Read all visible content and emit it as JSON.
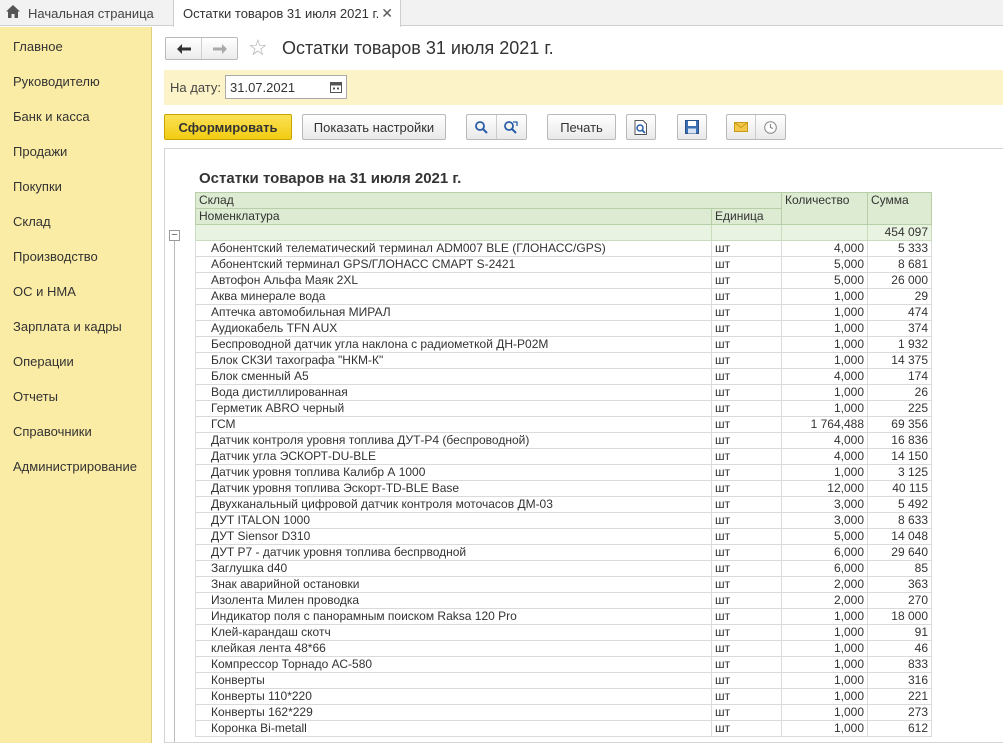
{
  "tabs": {
    "home_label": "Начальная страница",
    "doc_label": "Остатки товаров 31 июля 2021 г.",
    "close_glyph": "✕"
  },
  "sidebar": {
    "items": [
      {
        "label": "Главное"
      },
      {
        "label": "Руководителю"
      },
      {
        "label": "Банк и касса"
      },
      {
        "label": "Продажи"
      },
      {
        "label": "Покупки"
      },
      {
        "label": "Склад"
      },
      {
        "label": "Производство"
      },
      {
        "label": "ОС и НМА"
      },
      {
        "label": "Зарплата и кадры"
      },
      {
        "label": "Операции"
      },
      {
        "label": "Отчеты"
      },
      {
        "label": "Справочники"
      },
      {
        "label": "Администрирование"
      }
    ]
  },
  "header": {
    "back_glyph": "🡐",
    "forward_glyph": "🡒",
    "star_glyph": "☆",
    "title": "Остатки товаров 31 июля 2021 г."
  },
  "filters": {
    "date_label": "На дату:",
    "date_value": "31.07.2021"
  },
  "toolbar": {
    "generate_label": "Сформировать",
    "settings_label": "Показать настройки",
    "print_label": "Печать"
  },
  "report": {
    "title": "Остатки товаров на 31 июля 2021 г.",
    "col_warehouse": "Склад",
    "col_item": "Номенклатура",
    "col_unit": "Единица",
    "col_qty": "Количество",
    "col_sum": "Сумма",
    "outline_glyph": "−",
    "total_sum": "454 097",
    "rows": [
      {
        "name": "Абонентский телематический терминал ADM007 BLE (ГЛОНАСС/GPS)",
        "unit": "шт",
        "qty": "4,000",
        "sum": "5 333"
      },
      {
        "name": "Абонентский терминал GPS/ГЛОНАСС СМАРТ S-2421",
        "unit": "шт",
        "qty": "5,000",
        "sum": "8 681"
      },
      {
        "name": "Автофон Альфа Маяк 2XL",
        "unit": "шт",
        "qty": "5,000",
        "sum": "26 000"
      },
      {
        "name": "Аква минерале вода",
        "unit": "шт",
        "qty": "1,000",
        "sum": "29"
      },
      {
        "name": "Аптечка автомобильная МИРАЛ",
        "unit": "шт",
        "qty": "1,000",
        "sum": "474"
      },
      {
        "name": "Аудиокабель TFN AUX",
        "unit": "шт",
        "qty": "1,000",
        "sum": "374"
      },
      {
        "name": "Беспроводной датчик угла наклона с радиометкой ДН-Р02М",
        "unit": "шт",
        "qty": "1,000",
        "sum": "1 932"
      },
      {
        "name": "Блок СКЗИ тахографа \"НКМ-К\"",
        "unit": "шт",
        "qty": "1,000",
        "sum": "14 375"
      },
      {
        "name": "Блок сменный А5",
        "unit": "шт",
        "qty": "4,000",
        "sum": "174"
      },
      {
        "name": "Вода дистиллированная",
        "unit": "шт",
        "qty": "1,000",
        "sum": "26"
      },
      {
        "name": "Герметик ABRO черный",
        "unit": "шт",
        "qty": "1,000",
        "sum": "225"
      },
      {
        "name": "ГСМ",
        "unit": "шт",
        "qty": "1 764,488",
        "sum": "69 356"
      },
      {
        "name": "Датчик контроля уровня топлива ДУТ-Р4 (беспроводной)",
        "unit": "шт",
        "qty": "4,000",
        "sum": "16 836"
      },
      {
        "name": "Датчик угла ЭСКОРТ-DU-BLE",
        "unit": "шт",
        "qty": "4,000",
        "sum": "14 150"
      },
      {
        "name": "Датчик уровня топлива Калибр А 1000",
        "unit": "шт",
        "qty": "1,000",
        "sum": "3 125"
      },
      {
        "name": "Датчик уровня топлива Эскорт-TD-BLE Base",
        "unit": "шт",
        "qty": "12,000",
        "sum": "40 115"
      },
      {
        "name": "Двухканальный цифровой датчик контроля моточасов ДМ-03",
        "unit": "шт",
        "qty": "3,000",
        "sum": "5 492"
      },
      {
        "name": "ДУТ ITALON 1000",
        "unit": "шт",
        "qty": "3,000",
        "sum": "8 633"
      },
      {
        "name": "ДУТ Siensor D310",
        "unit": "шт",
        "qty": "5,000",
        "sum": "14 048"
      },
      {
        "name": "ДУТ Р7 - датчик уровня топлива беспрводной",
        "unit": "шт",
        "qty": "6,000",
        "sum": "29 640"
      },
      {
        "name": "Заглушка d40",
        "unit": "шт",
        "qty": "6,000",
        "sum": "85"
      },
      {
        "name": "Знак аварийной остановки",
        "unit": "шт",
        "qty": "2,000",
        "sum": "363"
      },
      {
        "name": "Изолента Милен проводка",
        "unit": "шт",
        "qty": "2,000",
        "sum": "270"
      },
      {
        "name": "Индикатор поля с панорамным поиском Raksa 120 Pro",
        "unit": "шт",
        "qty": "1,000",
        "sum": "18 000"
      },
      {
        "name": "Клей-карандаш скотч",
        "unit": "шт",
        "qty": "1,000",
        "sum": "91"
      },
      {
        "name": "клейкая лента 48*66",
        "unit": "шт",
        "qty": "1,000",
        "sum": "46"
      },
      {
        "name": "Компрессор Торнадо АС-580",
        "unit": "шт",
        "qty": "1,000",
        "sum": "833"
      },
      {
        "name": "Конверты",
        "unit": "шт",
        "qty": "1,000",
        "sum": "316"
      },
      {
        "name": "Конверты 110*220",
        "unit": "шт",
        "qty": "1,000",
        "sum": "221"
      },
      {
        "name": "Конверты 162*229",
        "unit": "шт",
        "qty": "1,000",
        "sum": "273"
      },
      {
        "name": "Коронка Bi-metall",
        "unit": "шт",
        "qty": "1,000",
        "sum": "612"
      }
    ]
  }
}
